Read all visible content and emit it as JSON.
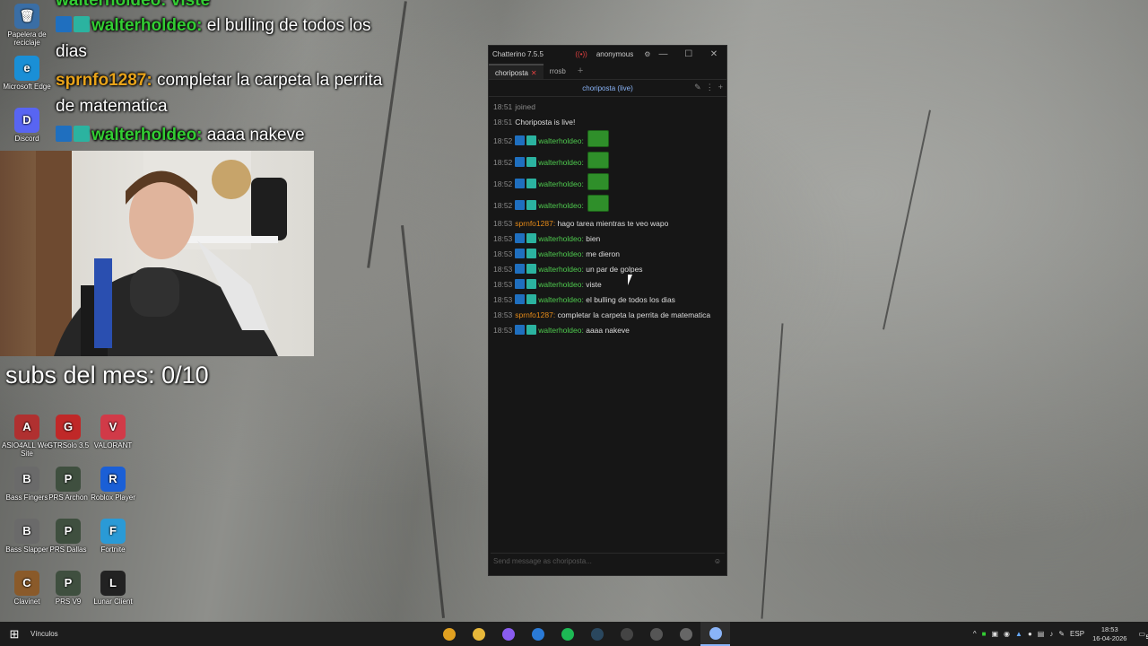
{
  "desktop": {
    "icons": [
      {
        "label": "Papelera de reciclaje",
        "color": "#3a6ea5",
        "glyph": "🗑"
      },
      {
        "label": "Microsoft Edge",
        "color": "#1a8fd6",
        "glyph": "e"
      },
      {
        "label": "Discord",
        "color": "#5865f2",
        "glyph": "D"
      },
      {
        "label": "ASIO4ALL Web Site",
        "color": "#b03030",
        "glyph": "A"
      },
      {
        "label": "GTRSolo 3.5",
        "color": "#c02828",
        "glyph": "G"
      },
      {
        "label": "VALORANT",
        "color": "#d13a48",
        "glyph": "V"
      },
      {
        "label": "Bass Fingers",
        "color": "#6a6a6a",
        "glyph": "B"
      },
      {
        "label": "PRS Archon",
        "color": "#3f4f3f",
        "glyph": "P"
      },
      {
        "label": "Roblox Player",
        "color": "#1a5fd6",
        "glyph": "R"
      },
      {
        "label": "Bass Slapper",
        "color": "#6a6a6a",
        "glyph": "B"
      },
      {
        "label": "PRS Dallas",
        "color": "#3f4f3f",
        "glyph": "P"
      },
      {
        "label": "Fortnite",
        "color": "#2a9ad6",
        "glyph": "F"
      },
      {
        "label": "Clavinet",
        "color": "#8a5a2a",
        "glyph": "C"
      },
      {
        "label": "PRS V9",
        "color": "#3f4f3f",
        "glyph": "P"
      },
      {
        "label": "Lunar Client",
        "color": "#222222",
        "glyph": "L"
      }
    ]
  },
  "overlay": {
    "top_fragment": "walterholdeo: viste",
    "line1_user": "walterholdeo:",
    "line1_text": " el bulling de todos los",
    "line1_cont": "dias",
    "line2_user": "sprnfo1287:",
    "line2_text": " completar la carpeta la perrita",
    "line2_cont": "de matematica",
    "line3_user": "walterholdeo:",
    "line3_text": " aaaa nakeve",
    "subs": "subs del mes: 0/10"
  },
  "chat_window": {
    "title": "Chatterino 7.5.5",
    "user": "anonymous",
    "tabs": [
      {
        "label": "choriposta",
        "active": true
      },
      {
        "label": "rrosb",
        "active": false
      }
    ],
    "channel": "choriposta (live)",
    "input_placeholder": "Send message as choriposta...",
    "messages": [
      {
        "kind": "system",
        "ts": "18:51",
        "text": "joined"
      },
      {
        "kind": "system",
        "ts": "18:51",
        "text": "Choriposta is live!"
      },
      {
        "kind": "emote",
        "ts": "18:52",
        "user": "walterholdeo:",
        "text": "",
        "color": "green"
      },
      {
        "kind": "emote",
        "ts": "18:52",
        "user": "walterholdeo:",
        "text": "",
        "color": "green"
      },
      {
        "kind": "emote",
        "ts": "18:52",
        "user": "walterholdeo:",
        "text": "",
        "color": "green"
      },
      {
        "kind": "emote",
        "ts": "18:52",
        "user": "walterholdeo:",
        "text": "",
        "color": "green"
      },
      {
        "kind": "plain",
        "ts": "18:53",
        "user": "sprnfo1287:",
        "text": "hago tarea mientras te veo wapo",
        "color": "orange"
      },
      {
        "kind": "badged",
        "ts": "18:53",
        "user": "walterholdeo:",
        "text": "bien",
        "color": "green"
      },
      {
        "kind": "badged",
        "ts": "18:53",
        "user": "walterholdeo:",
        "text": "me dieron",
        "color": "green"
      },
      {
        "kind": "badged",
        "ts": "18:53",
        "user": "walterholdeo:",
        "text": "un par de golpes",
        "color": "green"
      },
      {
        "kind": "badged",
        "ts": "18:53",
        "user": "walterholdeo:",
        "text": "viste",
        "color": "green"
      },
      {
        "kind": "badged",
        "ts": "18:53",
        "user": "walterholdeo:",
        "text": "el bulling de todos los dias",
        "color": "green"
      },
      {
        "kind": "plain",
        "ts": "18:53",
        "user": "sprnfo1287:",
        "text": "completar la carpeta la perrita de matematica",
        "color": "orange"
      },
      {
        "kind": "badged",
        "ts": "18:53",
        "user": "walterholdeo:",
        "text": "aaaa nakeve",
        "color": "green"
      }
    ]
  },
  "taskbar": {
    "links_label": "Vínculos",
    "apps": [
      {
        "name": "chrome",
        "color": "#e0a020"
      },
      {
        "name": "file-explorer",
        "color": "#e8b83a"
      },
      {
        "name": "messenger",
        "color": "#8a5cf0"
      },
      {
        "name": "calculator",
        "color": "#2a7ad6"
      },
      {
        "name": "spotify",
        "color": "#1db954"
      },
      {
        "name": "steam",
        "color": "#2a475e"
      },
      {
        "name": "obs",
        "color": "#444444"
      },
      {
        "name": "app-dark",
        "color": "#555555"
      },
      {
        "name": "app-gray",
        "color": "#666666"
      },
      {
        "name": "chatterino",
        "color": "#8ab4f8"
      }
    ],
    "language": "ESP",
    "time": "18:53",
    "date": "16-04-2026",
    "notification_count": "5"
  }
}
